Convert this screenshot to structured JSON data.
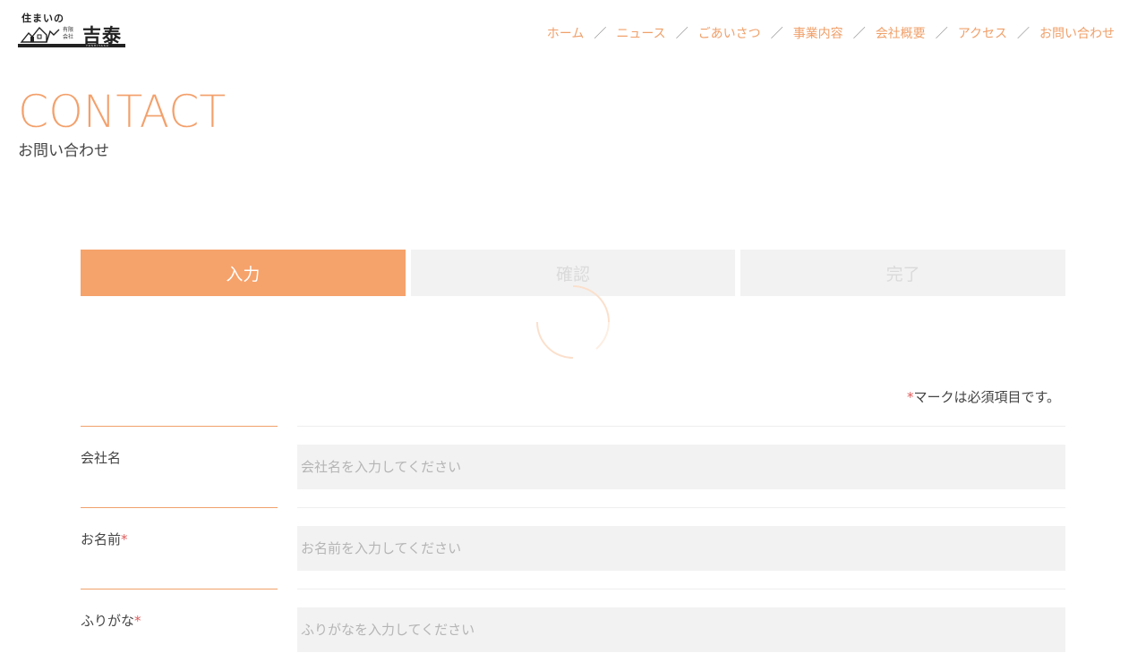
{
  "logo": {
    "top_text": "住まいの",
    "small_text": "有限会社",
    "main_text": "吉泰",
    "bar_text": "YOSHIYASU"
  },
  "nav": {
    "items": [
      "ホーム",
      "ニュース",
      "ごあいさつ",
      "事業内容",
      "会社概要",
      "アクセス",
      "お問い合わせ"
    ],
    "separator": "／"
  },
  "page": {
    "title": "CONTACT",
    "subtitle": "お問い合わせ"
  },
  "steps": [
    {
      "label": "入力",
      "state": "active"
    },
    {
      "label": "確認",
      "state": "inactive"
    },
    {
      "label": "完了",
      "state": "inactive"
    }
  ],
  "required_note": {
    "asterisk": "*",
    "text": "マークは必須項目です。"
  },
  "form": {
    "fields": [
      {
        "label": "会社名",
        "required": false,
        "placeholder": "会社名を入力してください"
      },
      {
        "label": "お名前",
        "required": true,
        "placeholder": "お名前を入力してください"
      },
      {
        "label": "ふりがな",
        "required": true,
        "placeholder": "ふりがなを入力してください"
      }
    ]
  },
  "colors": {
    "accent": "#f6a26b",
    "required": "#e05b5b",
    "input_bg": "#f2f2f2"
  }
}
